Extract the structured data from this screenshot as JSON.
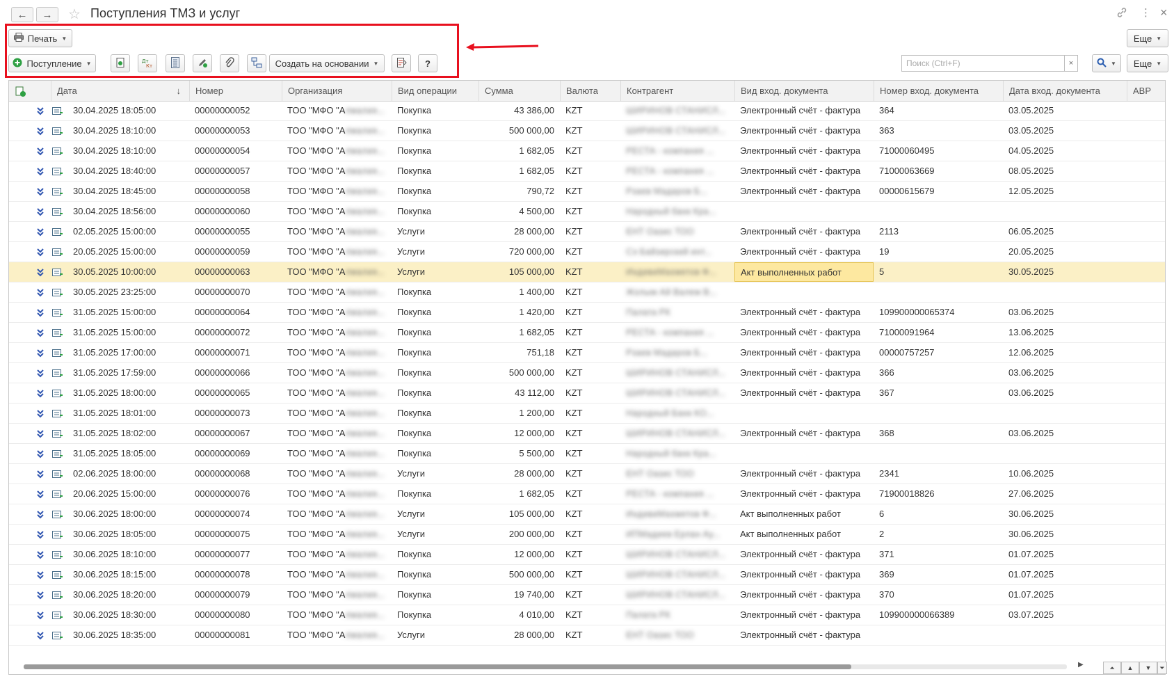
{
  "window": {
    "title": "Поступления ТМЗ и услуг",
    "back_icon": "←",
    "forward_icon": "→",
    "star_icon": "☆",
    "link_icon": "🔗",
    "menu_icon": "⋮",
    "close_icon": "×"
  },
  "toolbar": {
    "print_label": "Печать",
    "more_label": "Еще",
    "receipt_label": "Поступление",
    "create_based_label": "Создать на основании",
    "help_label": "?",
    "search_placeholder": "Поиск (Ctrl+F)",
    "search_clear": "×",
    "more_label_2": "Еще"
  },
  "table": {
    "columns": [
      "Дата",
      "Номер",
      "Организация",
      "Вид операции",
      "Сумма",
      "Валюта",
      "Контрагент",
      "Вид вход. документа",
      "Номер вход. документа",
      "Дата вход. документа",
      "АВР"
    ],
    "sort_indicator": "↓",
    "org_prefix": "ТОО \"МФО \"А",
    "rows": [
      {
        "date": "30.04.2025 18:05:00",
        "num": "00000000052",
        "op": "Покупка",
        "sum": "43 386,00",
        "cur": "KZT",
        "doctype": "Электронный счёт - фактура",
        "docnum": "364",
        "docdate": "03.05.2025"
      },
      {
        "date": "30.04.2025 18:10:00",
        "num": "00000000053",
        "op": "Покупка",
        "sum": "500 000,00",
        "cur": "KZT",
        "doctype": "Электронный счёт - фактура",
        "docnum": "363",
        "docdate": "03.05.2025"
      },
      {
        "date": "30.04.2025 18:10:00",
        "num": "00000000054",
        "op": "Покупка",
        "sum": "1 682,05",
        "cur": "KZT",
        "doctype": "Электронный счёт - фактура",
        "docnum": "71000060495",
        "docdate": "04.05.2025"
      },
      {
        "date": "30.04.2025 18:40:00",
        "num": "00000000057",
        "op": "Покупка",
        "sum": "1 682,05",
        "cur": "KZT",
        "doctype": "Электронный счёт - фактура",
        "docnum": "71000063669",
        "docdate": "08.05.2025"
      },
      {
        "date": "30.04.2025 18:45:00",
        "num": "00000000058",
        "op": "Покупка",
        "sum": "790,72",
        "cur": "KZT",
        "doctype": "Электронный счёт - фактура",
        "docnum": "00000615679",
        "docdate": "12.05.2025"
      },
      {
        "date": "30.04.2025 18:56:00",
        "num": "00000000060",
        "op": "Покупка",
        "sum": "4 500,00",
        "cur": "KZT",
        "doctype": "",
        "docnum": "",
        "docdate": ""
      },
      {
        "date": "02.05.2025 15:00:00",
        "num": "00000000055",
        "op": "Услуги",
        "sum": "28 000,00",
        "cur": "KZT",
        "doctype": "Электронный счёт - фактура",
        "docnum": "2113",
        "docdate": "06.05.2025"
      },
      {
        "date": "20.05.2025 15:00:00",
        "num": "00000000059",
        "op": "Услуги",
        "sum": "720 000,00",
        "cur": "KZT",
        "doctype": "Электронный счёт - фактура",
        "docnum": "19",
        "docdate": "20.05.2025"
      },
      {
        "date": "30.05.2025 10:00:00",
        "num": "00000000063",
        "op": "Услуги",
        "sum": "105 000,00",
        "cur": "KZT",
        "doctype": "Акт выполненных работ",
        "docnum": "5",
        "docdate": "30.05.2025"
      },
      {
        "date": "30.05.2025 23:25:00",
        "num": "00000000070",
        "op": "Покупка",
        "sum": "1 400,00",
        "cur": "KZT",
        "doctype": "",
        "docnum": "",
        "docdate": ""
      },
      {
        "date": "31.05.2025 15:00:00",
        "num": "00000000064",
        "op": "Покупка",
        "sum": "1 420,00",
        "cur": "KZT",
        "doctype": "Электронный счёт - фактура",
        "docnum": "109900000065374",
        "docdate": "03.06.2025"
      },
      {
        "date": "31.05.2025 15:00:00",
        "num": "00000000072",
        "op": "Покупка",
        "sum": "1 682,05",
        "cur": "KZT",
        "doctype": "Электронный счёт - фактура",
        "docnum": "71000091964",
        "docdate": "13.06.2025"
      },
      {
        "date": "31.05.2025 17:00:00",
        "num": "00000000071",
        "op": "Покупка",
        "sum": "751,18",
        "cur": "KZT",
        "doctype": "Электронный счёт - фактура",
        "docnum": "00000757257",
        "docdate": "12.06.2025"
      },
      {
        "date": "31.05.2025 17:59:00",
        "num": "00000000066",
        "op": "Покупка",
        "sum": "500 000,00",
        "cur": "KZT",
        "doctype": "Электронный счёт - фактура",
        "docnum": "366",
        "docdate": "03.06.2025"
      },
      {
        "date": "31.05.2025 18:00:00",
        "num": "00000000065",
        "op": "Покупка",
        "sum": "43 112,00",
        "cur": "KZT",
        "doctype": "Электронный счёт - фактура",
        "docnum": "367",
        "docdate": "03.06.2025"
      },
      {
        "date": "31.05.2025 18:01:00",
        "num": "00000000073",
        "op": "Покупка",
        "sum": "1 200,00",
        "cur": "KZT",
        "doctype": "",
        "docnum": "",
        "docdate": ""
      },
      {
        "date": "31.05.2025 18:02:00",
        "num": "00000000067",
        "op": "Покупка",
        "sum": "12 000,00",
        "cur": "KZT",
        "doctype": "Электронный счёт - фактура",
        "docnum": "368",
        "docdate": "03.06.2025"
      },
      {
        "date": "31.05.2025 18:05:00",
        "num": "00000000069",
        "op": "Покупка",
        "sum": "5 500,00",
        "cur": "KZT",
        "doctype": "",
        "docnum": "",
        "docdate": ""
      },
      {
        "date": "02.06.2025 18:00:00",
        "num": "00000000068",
        "op": "Услуги",
        "sum": "28 000,00",
        "cur": "KZT",
        "doctype": "Электронный счёт - фактура",
        "docnum": "2341",
        "docdate": "10.06.2025"
      },
      {
        "date": "20.06.2025 15:00:00",
        "num": "00000000076",
        "op": "Покупка",
        "sum": "1 682,05",
        "cur": "KZT",
        "doctype": "Электронный счёт - фактура",
        "docnum": "71900018826",
        "docdate": "27.06.2025"
      },
      {
        "date": "30.06.2025 18:00:00",
        "num": "00000000074",
        "op": "Услуги",
        "sum": "105 000,00",
        "cur": "KZT",
        "doctype": "Акт выполненных работ",
        "docnum": "6",
        "docdate": "30.06.2025"
      },
      {
        "date": "30.06.2025 18:05:00",
        "num": "00000000075",
        "op": "Услуги",
        "sum": "200 000,00",
        "cur": "KZT",
        "doctype": "Акт выполненных работ",
        "docnum": "2",
        "docdate": "30.06.2025"
      },
      {
        "date": "30.06.2025 18:10:00",
        "num": "00000000077",
        "op": "Покупка",
        "sum": "12 000,00",
        "cur": "KZT",
        "doctype": "Электронный счёт - фактура",
        "docnum": "371",
        "docdate": "01.07.2025"
      },
      {
        "date": "30.06.2025 18:15:00",
        "num": "00000000078",
        "op": "Покупка",
        "sum": "500 000,00",
        "cur": "KZT",
        "doctype": "Электронный счёт - фактура",
        "docnum": "369",
        "docdate": "01.07.2025"
      },
      {
        "date": "30.06.2025 18:20:00",
        "num": "00000000079",
        "op": "Покупка",
        "sum": "19 740,00",
        "cur": "KZT",
        "doctype": "Электронный счёт - фактура",
        "docnum": "370",
        "docdate": "01.07.2025"
      },
      {
        "date": "30.06.2025 18:30:00",
        "num": "00000000080",
        "op": "Покупка",
        "sum": "4 010,00",
        "cur": "KZT",
        "doctype": "Электронный счёт - фактура",
        "docnum": "109900000066389",
        "docdate": "03.07.2025"
      },
      {
        "date": "30.06.2025 18:35:00",
        "num": "00000000081",
        "op": "Услуги",
        "sum": "28 000,00",
        "cur": "KZT",
        "doctype": "Электронный счёт - фактура",
        "docnum": "",
        "docdate": ""
      }
    ],
    "selected_row_index": 8
  },
  "colors": {
    "highlight_border": "#e8101e",
    "selected_row": "#fbf0c6",
    "posted_icon": "#2f55b0"
  }
}
